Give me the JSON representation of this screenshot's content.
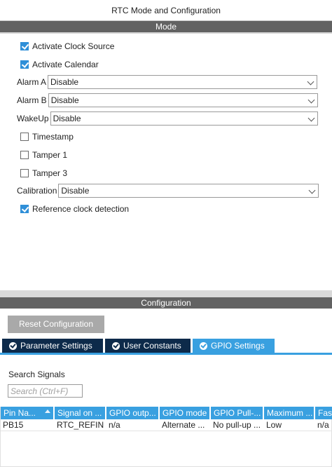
{
  "title": "RTC Mode and Configuration",
  "mode": {
    "header": "Mode",
    "checkboxes_top": [
      {
        "label": "Activate Clock Source",
        "checked": true
      },
      {
        "label": "Activate Calendar",
        "checked": true
      }
    ],
    "alarm_a": {
      "label": "Alarm A",
      "value": "Disable"
    },
    "alarm_b": {
      "label": "Alarm B",
      "value": "Disable"
    },
    "wakeup": {
      "label": "WakeUp",
      "value": "Disable"
    },
    "checkboxes_mid": [
      {
        "label": "Timestamp",
        "checked": false
      },
      {
        "label": "Tamper 1",
        "checked": false
      },
      {
        "label": "Tamper 3",
        "checked": false
      }
    ],
    "calibration": {
      "label": "Calibration",
      "value": "Disable"
    },
    "reference_clock": {
      "label": "Reference clock detection",
      "checked": true
    }
  },
  "configuration": {
    "header": "Configuration",
    "reset_button": "Reset Configuration",
    "tabs": [
      {
        "label": "Parameter Settings",
        "active": false
      },
      {
        "label": "User Constants",
        "active": false
      },
      {
        "label": "GPIO Settings",
        "active": true
      }
    ],
    "search": {
      "label": "Search Signals",
      "placeholder": "Search (Ctrl+F)",
      "value": ""
    },
    "table": {
      "columns": [
        "Pin Na...",
        "Signal on ...",
        "GPIO outp...",
        "GPIO mode",
        "GPIO Pull-...",
        "Maximum ...",
        "Fas"
      ],
      "rows": [
        [
          "PB15",
          "RTC_REFIN",
          "n/a",
          "Alternate ...",
          "No pull-up ...",
          "Low",
          "n/a"
        ]
      ]
    }
  },
  "colors": {
    "header_gray": "#626262",
    "accent_blue": "#39a0e0",
    "tab_dark": "#0d2a4a",
    "button_gray": "#a9a9a9"
  }
}
